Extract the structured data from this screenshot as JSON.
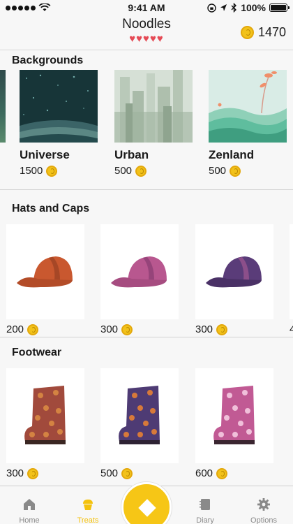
{
  "status": {
    "time": "9:41 AM",
    "battery": "100%"
  },
  "header": {
    "title": "Noodles",
    "hearts": "♥♥♥♥♥",
    "coins": "1470"
  },
  "sections": {
    "backgrounds": {
      "title": "Backgrounds",
      "items": [
        {
          "name": "Universe",
          "price": "1500"
        },
        {
          "name": "Urban",
          "price": "500"
        },
        {
          "name": "Zenland",
          "price": "500"
        }
      ]
    },
    "hats": {
      "title": "Hats and Caps",
      "items": [
        {
          "price": "200",
          "color": "#c9582f"
        },
        {
          "price": "300",
          "color": "#b8578f"
        },
        {
          "price": "300",
          "color": "#5a3c79"
        }
      ],
      "partial_price": "4"
    },
    "footwear": {
      "title": "Footwear",
      "items": [
        {
          "price": "300",
          "color": "#a14a3c"
        },
        {
          "price": "500",
          "color": "#4e3b74"
        },
        {
          "price": "600",
          "color": "#c15a94"
        }
      ]
    }
  },
  "tabs": [
    {
      "label": "Home",
      "icon": "home-icon"
    },
    {
      "label": "Treats",
      "icon": "cupcake-icon",
      "active": true
    },
    {
      "label": "Diary",
      "icon": "notebook-icon"
    },
    {
      "label": "Options",
      "icon": "gear-icon"
    }
  ],
  "colors": {
    "accent": "#f6c616",
    "hearts": "#e54a55",
    "coin": "#f2c21a"
  }
}
